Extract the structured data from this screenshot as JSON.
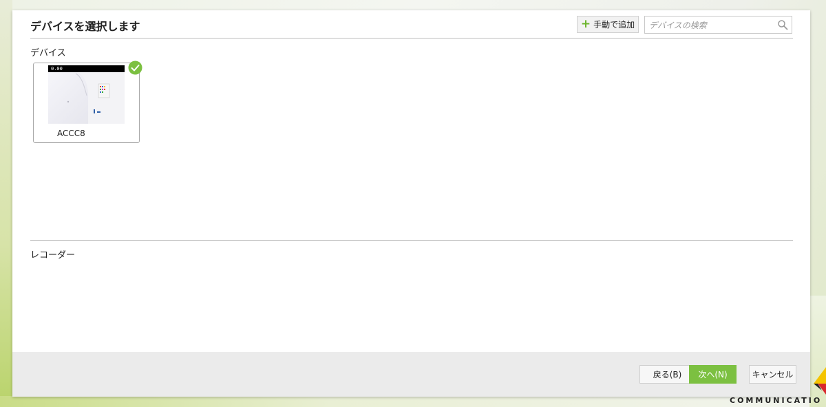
{
  "dialog": {
    "title": "デバイスを選択します",
    "add_manual_label": "手動で追加",
    "search_placeholder": "デバイスの検索"
  },
  "devices_section": {
    "label": "デバイス",
    "items": [
      {
        "name": "ACCC8",
        "thumb_text": "0.00",
        "selected": true
      }
    ]
  },
  "recorders_section": {
    "label": "レコーダー"
  },
  "footer": {
    "back_label": "戻る(B)",
    "next_label": "次へ(N)",
    "cancel_label": "キャンセル"
  },
  "branding": {
    "partial_text": "COMMUNICATIO"
  },
  "colors": {
    "accent": "#7cc041",
    "plus": "#6cb52c",
    "check_badge": "#7cc041"
  },
  "icons": {
    "add": "plus-icon",
    "search": "search-icon",
    "selected": "check-icon"
  }
}
